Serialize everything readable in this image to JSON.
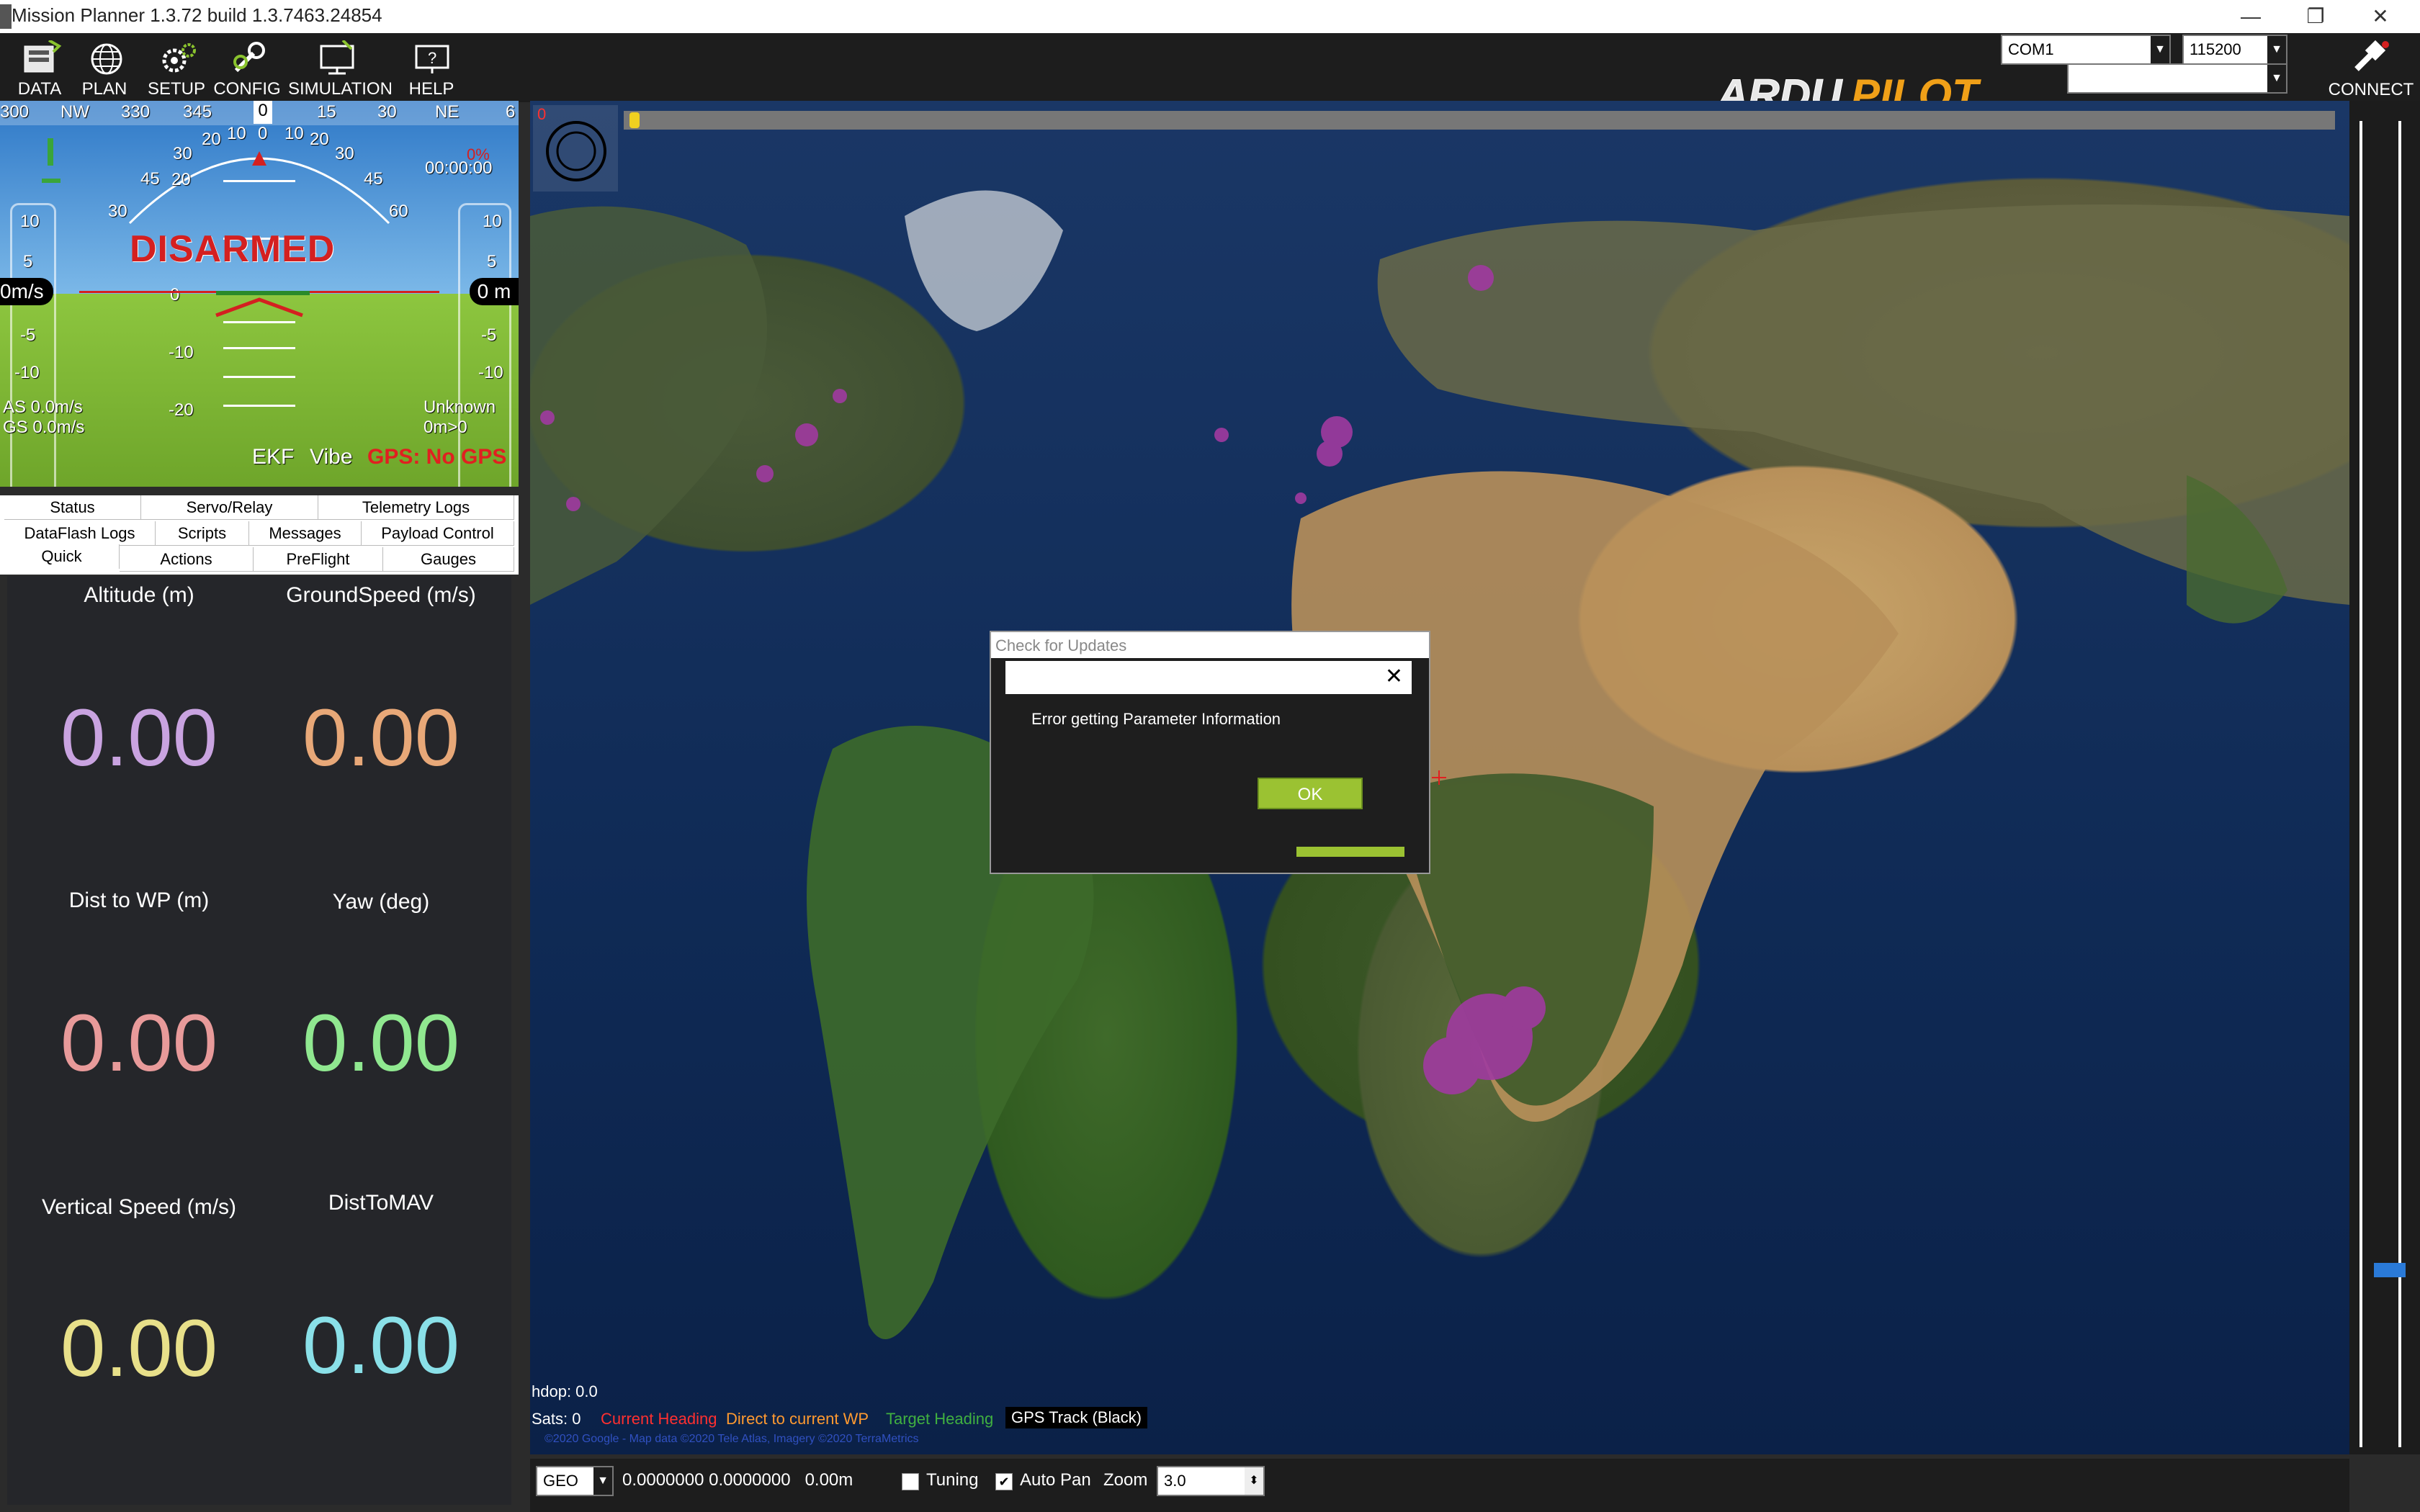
{
  "window": {
    "title": "Mission Planner 1.3.72 build 1.3.7463.24854",
    "minimize": "—",
    "restore": "❐",
    "close": "✕"
  },
  "menu": [
    {
      "label": "DATA",
      "icon": "data-icon"
    },
    {
      "label": "PLAN",
      "icon": "globe-icon"
    },
    {
      "label": "SETUP",
      "icon": "setup-gears-icon"
    },
    {
      "label": "CONFIG",
      "icon": "wrench-icon"
    },
    {
      "label": "SIMULATION",
      "icon": "simulation-icon"
    },
    {
      "label": "HELP",
      "icon": "help-icon"
    }
  ],
  "brand": {
    "logo": "ARDUPILOT",
    "logo_a": "ARDU",
    "logo_b": "PILOT"
  },
  "connection": {
    "port": "COM1",
    "baud": "115200",
    "connect_label": "CONNECT"
  },
  "hud": {
    "heading_ticks": [
      "300",
      "NW",
      "330",
      "345",
      "0",
      "15",
      "30",
      "NE",
      "6"
    ],
    "heading_value": "0",
    "status": "DISARMED",
    "speed_box": "0m/s",
    "alt_box": "0 m",
    "speed_ticks": [
      "10",
      "5",
      "-5",
      "-10"
    ],
    "alt_ticks": [
      "10",
      "5",
      "-5",
      "-10"
    ],
    "pitch_ticks": [
      "20",
      "0",
      "-10",
      "-20"
    ],
    "roll_ticks": [
      "30",
      "45",
      "60",
      "30",
      "20",
      "10",
      "0",
      "10",
      "20",
      "30",
      "45",
      "60"
    ],
    "battery": "0%",
    "timer": "00:00:00",
    "airspeed": "AS 0.0m/s",
    "groundspeed": "GS 0.0m/s",
    "mode": "Unknown",
    "wp": "0m>0",
    "ekf": "EKF",
    "vibe": "Vibe",
    "gps": "GPS: No GPS"
  },
  "tabs": {
    "row1": [
      "Status",
      "Servo/Relay",
      "Telemetry Logs"
    ],
    "row2": [
      "DataFlash Logs",
      "Scripts",
      "Messages",
      "Payload Control"
    ],
    "row3": [
      "Quick",
      "Actions",
      "PreFlight",
      "Gauges"
    ]
  },
  "quick": [
    {
      "label": "Altitude (m)",
      "value": "0.00",
      "color": "#c9a3e0"
    },
    {
      "label": "GroundSpeed (m/s)",
      "value": "0.00",
      "color": "#e8a878"
    },
    {
      "label": "Dist to WP (m)",
      "value": "0.00",
      "color": "#e89a9a"
    },
    {
      "label": "Yaw (deg)",
      "value": "0.00",
      "color": "#90e890"
    },
    {
      "label": "Vertical Speed (m/s)",
      "value": "0.00",
      "color": "#e8e08a"
    },
    {
      "label": "DistToMAV",
      "value": "0.00",
      "color": "#8ae0e8"
    }
  ],
  "map": {
    "hdop": "hdop: 0.0",
    "sats": "Sats: 0",
    "legend": [
      {
        "label": "Current Heading",
        "color": "#ff3030"
      },
      {
        "label": "Direct to current WP",
        "color": "#ff9a30"
      },
      {
        "label": "Target Heading",
        "color": "#40b040"
      },
      {
        "label": "GPS Track (Black)",
        "color": "#ffffff"
      }
    ],
    "attribution": "©2020 Google - Map data ©2020 Tele Atlas, Imagery ©2020 TerraMetrics",
    "timeline_marker": "0"
  },
  "dialog": {
    "title": "Check for Updates",
    "message": "Error getting Parameter Information",
    "ok": "OK",
    "close": "✕"
  },
  "bottombar": {
    "coord_system": "GEO",
    "coords": "0.0000000 0.0000000   0.00m",
    "tuning": "Tuning",
    "autopan": "Auto Pan",
    "zoom_label": "Zoom",
    "zoom_value": "3.0"
  }
}
